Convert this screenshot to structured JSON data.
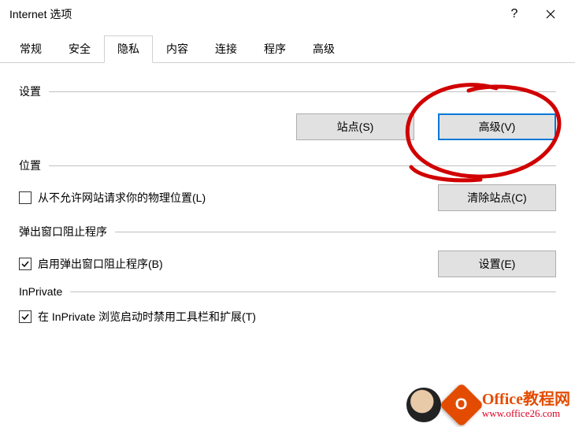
{
  "window": {
    "title": "Internet 选项",
    "help": "?",
    "close_label": "close"
  },
  "tabs": {
    "items": [
      "常规",
      "安全",
      "隐私",
      "内容",
      "连接",
      "程序",
      "高级"
    ],
    "active_index": 2
  },
  "sections": {
    "settings": {
      "label": "设置",
      "sites_btn": "站点(S)",
      "advanced_btn": "高级(V)"
    },
    "location": {
      "label": "位置",
      "never_allow": {
        "text": "从不允许网站请求你的物理位置(L)",
        "checked": false
      },
      "clear_sites_btn": "清除站点(C)"
    },
    "popup": {
      "label": "弹出窗口阻止程序",
      "enable": {
        "text": "启用弹出窗口阻止程序(B)",
        "checked": true
      },
      "settings_btn": "设置(E)"
    },
    "inprivate": {
      "label": "InPrivate",
      "disable_ext": {
        "text": "在 InPrivate 浏览启动时禁用工具栏和扩展(T)",
        "checked": true
      }
    }
  },
  "watermark": {
    "line1": "Office教程网",
    "line2": "www.office26.com"
  }
}
